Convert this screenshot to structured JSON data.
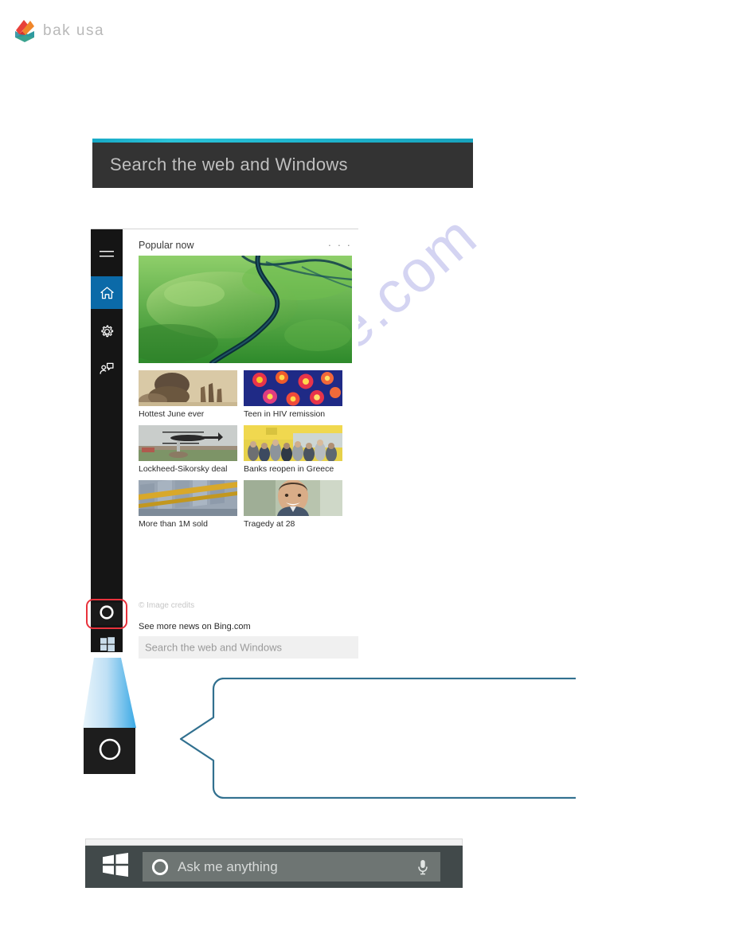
{
  "brand": {
    "wordmark": "bak usa",
    "logo_icon": "bakusa-diamond-logo-icon",
    "colors": {
      "red": "#e8413a",
      "orange": "#f0862a",
      "teal": "#2e9aa0",
      "green": "#3fae8e",
      "wordmark": "#b9b9b9"
    }
  },
  "watermark": {
    "text": "manualshive.com",
    "color": "#cdcdf0"
  },
  "top_search": {
    "placeholder": "Search the web and Windows",
    "accent_color": "#1fb6cf",
    "background": "#333333"
  },
  "cortana_panel": {
    "rail": {
      "items": [
        {
          "id": "hamburger",
          "icon": "hamburger-menu-icon",
          "label": "Menu",
          "active": false
        },
        {
          "id": "home",
          "icon": "home-icon",
          "label": "Home",
          "active": true
        },
        {
          "id": "settings",
          "icon": "gear-icon",
          "label": "Settings",
          "active": false
        },
        {
          "id": "feedback",
          "icon": "feedback-person-icon",
          "label": "Feedback",
          "active": false
        }
      ],
      "cortana_button_icon": "cortana-circle-icon",
      "start_button_icon": "windows-logo-icon",
      "active_color": "#0b6aa8",
      "background": "#151515"
    },
    "section_title": "Popular now",
    "more_menu": "· · ·",
    "hero": {
      "caption": "",
      "image": "aerial-green-river-landscape"
    },
    "news": [
      {
        "label": "Hottest June ever",
        "image": "heat-crowd-silhouette"
      },
      {
        "label": "Teen in HIV remission",
        "image": "virus-microscopy-cells"
      },
      {
        "label": "Lockheed-Sikorsky deal",
        "image": "black-helicopter-landing"
      },
      {
        "label": "Banks reopen in Greece",
        "image": "bank-queue-crowd"
      },
      {
        "label": "More than 1M sold",
        "image": "golden-gears-machinery"
      },
      {
        "label": "Tragedy at 28",
        "image": "smiling-young-man-portrait"
      }
    ],
    "image_credits": "© Image credits",
    "see_more": "See more news on Bing.com",
    "search_placeholder": "Search the web and Windows"
  },
  "highlight": {
    "color": "#e8323c",
    "target": "cortana-circle-icon"
  },
  "magnifier": {
    "icon": "cortana-circle-icon",
    "beam_color": "#4fb8e8"
  },
  "callout": {
    "text": "",
    "border_color": "#31708f"
  },
  "taskbar": {
    "start_icon": "windows-logo-icon",
    "cortana_icon": "cortana-circle-icon",
    "placeholder": "Ask me anything",
    "mic_icon": "microphone-icon",
    "background": "#41494a",
    "searchbox_background": "#6e7573"
  }
}
